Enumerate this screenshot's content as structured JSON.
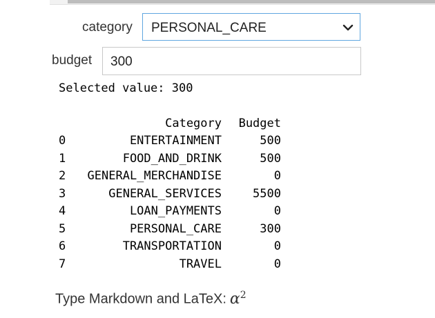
{
  "widgets": {
    "category": {
      "label": "category",
      "selected": "PERSONAL_CARE"
    },
    "budget": {
      "label": "budget",
      "value": "300"
    }
  },
  "output": {
    "selected_text": "Selected value: 300",
    "table": {
      "columns": [
        "",
        "Category",
        "Budget"
      ],
      "rows": [
        {
          "index": "0",
          "category": "ENTERTAINMENT",
          "budget": "500"
        },
        {
          "index": "1",
          "category": "FOOD_AND_DRINK",
          "budget": "500"
        },
        {
          "index": "2",
          "category": "GENERAL_MERCHANDISE",
          "budget": "0"
        },
        {
          "index": "3",
          "category": "GENERAL_SERVICES",
          "budget": "5500"
        },
        {
          "index": "4",
          "category": "LOAN_PAYMENTS",
          "budget": "0"
        },
        {
          "index": "5",
          "category": "PERSONAL_CARE",
          "budget": "300"
        },
        {
          "index": "6",
          "category": "TRANSPORTATION",
          "budget": "0"
        },
        {
          "index": "7",
          "category": "TRAVEL",
          "budget": "0"
        }
      ]
    }
  },
  "markdown_cell": {
    "prompt": "Type Markdown and LaTeX:",
    "latex_symbol": "α",
    "latex_superscript": "2"
  }
}
